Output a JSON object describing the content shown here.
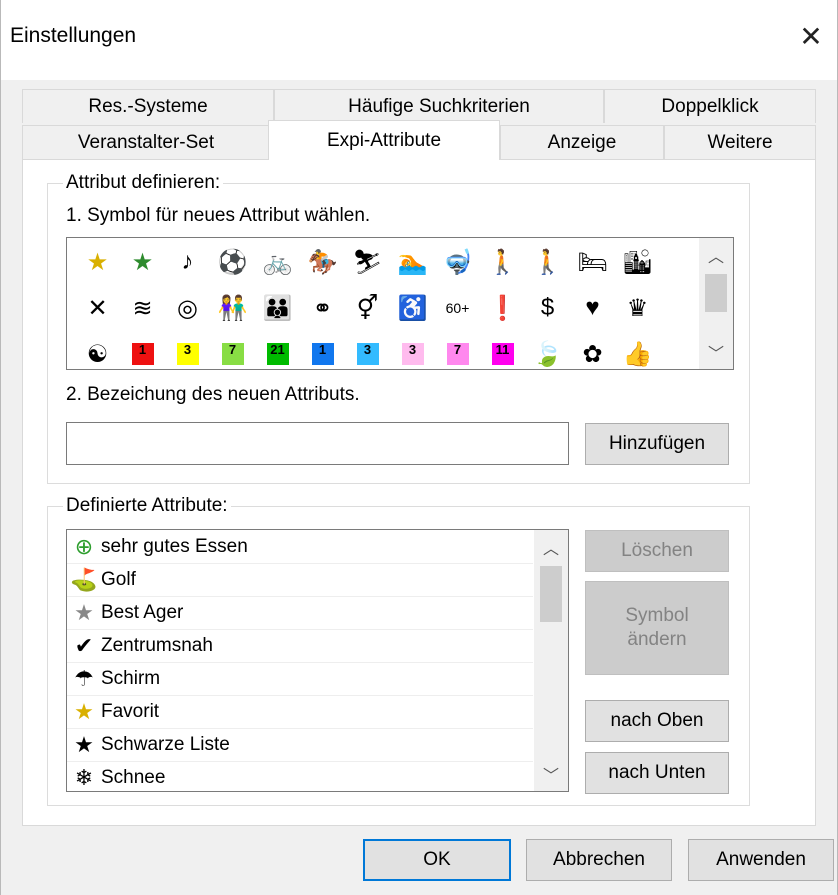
{
  "window": {
    "title": "Einstellungen",
    "close_symbol": "✕"
  },
  "tabs": {
    "row1": [
      "Res.-Systeme",
      "Häufige Suchkriterien",
      "Doppelklick"
    ],
    "row2": [
      "Veranstalter-Set",
      "Expi-Attribute",
      "Anzeige",
      "Weitere"
    ],
    "active": "Expi-Attribute"
  },
  "define_group": {
    "label": "Attribut definieren:",
    "step1": "1. Symbol für neues Attribut wählen.",
    "step2": "2. Bezeichung des neuen Attributs.",
    "name_value": "",
    "add_button": "Hinzufügen",
    "symbols_row1": [
      {
        "glyph": "★",
        "color": "#d9b000",
        "name": "star-gold-icon"
      },
      {
        "glyph": "★",
        "color": "#2e8b2e",
        "name": "star-green-icon"
      },
      {
        "glyph": "♪",
        "color": "#000",
        "name": "music-note-icon"
      },
      {
        "glyph": "⚽",
        "color": "#000",
        "name": "soccer-ball-icon"
      },
      {
        "glyph": "🚲",
        "color": "#000",
        "name": "bicycle-icon"
      },
      {
        "glyph": "🏇",
        "color": "#000",
        "name": "horse-riding-icon"
      },
      {
        "glyph": "⛷",
        "color": "#000",
        "name": "skiing-icon"
      },
      {
        "glyph": "🏊",
        "color": "#000",
        "name": "swimming-icon"
      },
      {
        "glyph": "🤿",
        "color": "#000",
        "name": "diving-mask-icon"
      },
      {
        "glyph": "🚶",
        "color": "#000",
        "name": "hiking-couple-icon"
      },
      {
        "glyph": "🚶",
        "color": "#000",
        "name": "hiker-icon"
      },
      {
        "glyph": "🛏",
        "color": "#000",
        "name": "spa-lounger-icon"
      },
      {
        "glyph": "🏙",
        "color": "#000",
        "name": "city-skyline-icon"
      }
    ],
    "symbols_row2": [
      {
        "glyph": "✕",
        "color": "#000",
        "name": "cutlery-icon"
      },
      {
        "glyph": "≋",
        "color": "#000",
        "name": "waves-icon"
      },
      {
        "glyph": "◎",
        "color": "#000",
        "name": "target-icon"
      },
      {
        "glyph": "👫",
        "color": "#000",
        "name": "couple-icon"
      },
      {
        "glyph": "👪",
        "color": "#000",
        "name": "family-icon"
      },
      {
        "glyph": "⚭",
        "color": "#000",
        "name": "wedding-rings-icon"
      },
      {
        "glyph": "⚥",
        "color": "#000",
        "name": "gender-icon"
      },
      {
        "glyph": "♿",
        "color": "#000",
        "name": "wheelchair-icon"
      },
      {
        "glyph": "60+",
        "color": "#000",
        "name": "senior-60-plus-icon"
      },
      {
        "glyph": "❗",
        "color": "#000",
        "name": "exclamation-icon"
      },
      {
        "glyph": "$",
        "color": "#000",
        "name": "dollar-icon"
      },
      {
        "glyph": "♥",
        "color": "#000",
        "name": "heart-icon"
      },
      {
        "glyph": "♛",
        "color": "#000",
        "name": "crown-icon"
      }
    ],
    "symbols_row3": [
      {
        "glyph": "☯",
        "bg": "transparent",
        "name": "yin-yang-icon"
      },
      {
        "glyph": "1",
        "bg": "#ee1111",
        "name": "age-1-red-icon"
      },
      {
        "glyph": "3",
        "bg": "#ffff00",
        "name": "age-3-yellow-icon"
      },
      {
        "glyph": "7",
        "bg": "#88dd44",
        "name": "age-7-lightgreen-icon"
      },
      {
        "glyph": "21",
        "bg": "#00bb00",
        "name": "age-21-green-icon"
      },
      {
        "glyph": "1",
        "bg": "#1177ee",
        "name": "age-1-blue-icon"
      },
      {
        "glyph": "3",
        "bg": "#33bbff",
        "name": "age-3-lightblue-icon"
      },
      {
        "glyph": "3",
        "bg": "#ffbbee",
        "name": "age-3-pink-icon"
      },
      {
        "glyph": "7",
        "bg": "#ff88ee",
        "name": "age-7-magenta-light-icon"
      },
      {
        "glyph": "11",
        "bg": "#ff00ee",
        "name": "age-11-magenta-icon"
      },
      {
        "glyph": "🍃",
        "bg": "transparent",
        "name": "leaf-icon"
      },
      {
        "glyph": "✿",
        "bg": "transparent",
        "name": "flower-icon"
      },
      {
        "glyph": "👍",
        "bg": "transparent",
        "name": "thumbs-up-icon"
      }
    ]
  },
  "defined_group": {
    "label": "Definierte Attribute:",
    "items": [
      {
        "icon": "⊕",
        "color": "#2e9e2e",
        "name": "plus-circle-icon",
        "label": "sehr gutes Essen"
      },
      {
        "icon": "⛳",
        "color": "#000",
        "name": "golf-icon",
        "label": "Golf"
      },
      {
        "icon": "★",
        "color": "#888",
        "name": "star-outline-icon",
        "label": "Best Ager"
      },
      {
        "icon": "✔",
        "color": "#000",
        "name": "checkmark-icon",
        "label": "Zentrumsnah"
      },
      {
        "icon": "☂",
        "color": "#000",
        "name": "umbrella-icon",
        "label": "Schirm"
      },
      {
        "icon": "★",
        "color": "#d9b000",
        "name": "star-gold-icon",
        "label": "Favorit"
      },
      {
        "icon": "★",
        "color": "#000",
        "name": "star-black-icon",
        "label": "Schwarze Liste"
      },
      {
        "icon": "❄",
        "color": "#000",
        "name": "snow-icon",
        "label": "Schnee"
      }
    ],
    "delete_button": "Löschen",
    "change_symbol_button": "Symbol ändern",
    "up_button": "nach Oben",
    "down_button": "nach Unten"
  },
  "footer": {
    "ok": "OK",
    "cancel": "Abbrechen",
    "apply": "Anwenden"
  }
}
